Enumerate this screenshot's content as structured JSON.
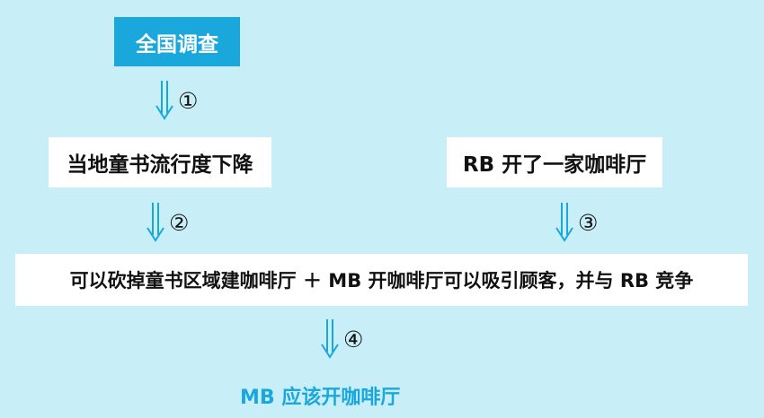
{
  "nodes": {
    "survey": "全国调查",
    "decline": "当地童书流行度下降",
    "rb_cafe": "RB 开了一家咖啡厅",
    "combined": "可以砍掉童书区域建咖啡厅 ＋ MB 开咖啡厅可以吸引顾客，并与 RB 竞争",
    "conclusion": "MB 应该开咖啡厅"
  },
  "arrows": {
    "a1": "①",
    "a2": "②",
    "a3": "③",
    "a4": "④"
  },
  "colors": {
    "background": "#c8eef8",
    "accent": "#1aa8dc",
    "box": "#ffffff"
  }
}
